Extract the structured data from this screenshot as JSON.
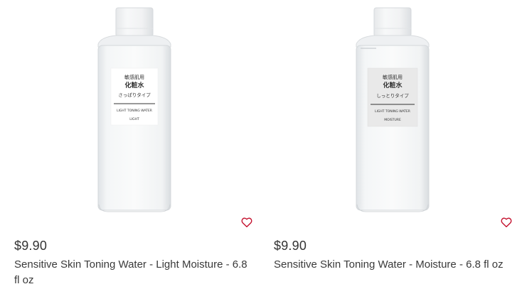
{
  "products": [
    {
      "price": "$9.90",
      "name": "Sensitive Skin Toning Water - Light Moisture - 6.8 fl oz",
      "label_jp_line1": "敏感肌用",
      "label_jp_line2": "化粧水",
      "label_jp_line3": "さっぱりタイプ",
      "label_en_line1": "LIGHT TONING WATER",
      "label_en_line2": "LIGHT"
    },
    {
      "price": "$9.90",
      "name": "Sensitive Skin Toning Water - Moisture - 6.8 fl oz",
      "label_jp_line1": "敏感肌用",
      "label_jp_line2": "化粧水",
      "label_jp_line3": "しっとりタイプ",
      "label_en_line1": "LIGHT TONING WATER",
      "label_en_line2": "MOISTURE"
    }
  ],
  "icons": {
    "wishlist": "heart-outline-icon"
  },
  "colors": {
    "heart_stroke": "#c4122f",
    "text": "#333333"
  }
}
